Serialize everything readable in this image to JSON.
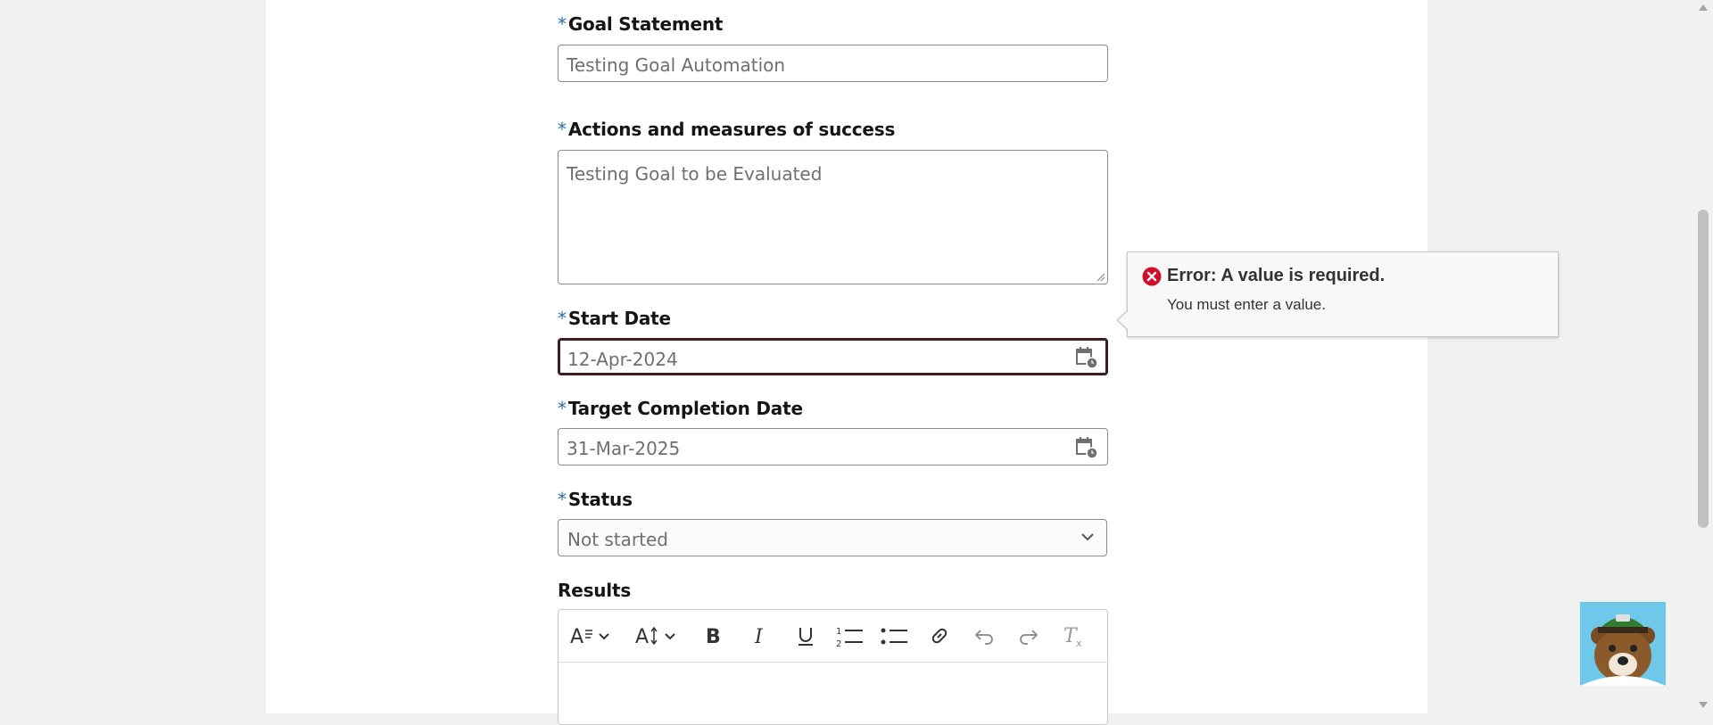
{
  "form": {
    "required_marker": "*",
    "goal_statement": {
      "label": "Goal Statement",
      "value": "Testing Goal Automation"
    },
    "actions": {
      "label": "Actions and measures of success",
      "value": "Testing Goal to be Evaluated"
    },
    "start_date": {
      "label": "Start Date",
      "value": "12-Apr-2024"
    },
    "target_date": {
      "label": "Target Completion Date",
      "value": "31-Mar-2025"
    },
    "status": {
      "label": "Status",
      "value": "Not started"
    },
    "results": {
      "label": "Results"
    }
  },
  "error_tooltip": {
    "title": "Error: A value is required.",
    "message": "You must enter a value."
  },
  "editor_toolbar": {
    "buttons": [
      "font-style",
      "font-size",
      "bold",
      "italic",
      "underline",
      "numbered-list",
      "bulleted-list",
      "link",
      "undo",
      "redo",
      "clear-formatting"
    ]
  },
  "colors": {
    "required_marker": "#2a6cae",
    "error_icon": "#d0102a",
    "error_border": "#3b1f1f",
    "mascot_bg": "#6ec8ea"
  }
}
